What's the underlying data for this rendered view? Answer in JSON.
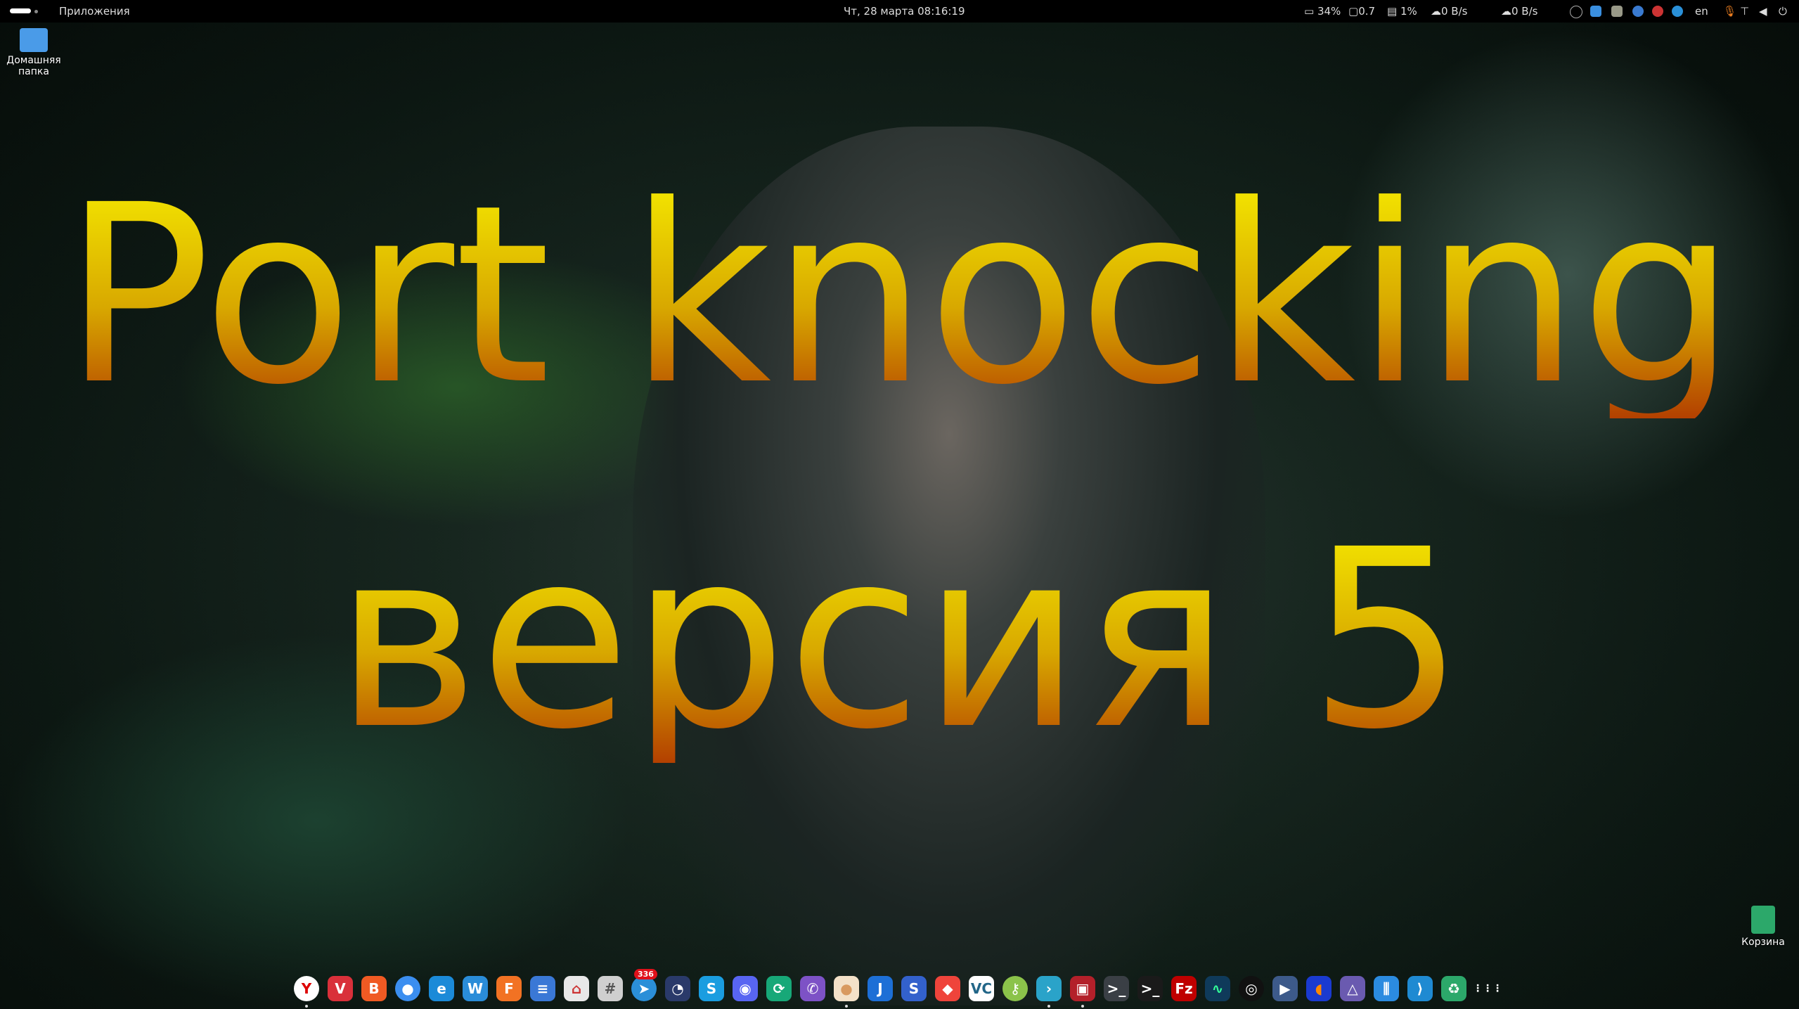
{
  "topbar": {
    "apps_label": "Приложения",
    "clock": "Чт, 28 марта  08:16:19",
    "cpu": "34%",
    "load": "0.7",
    "mem": "1%",
    "download": "0 B/s",
    "upload": "0 B/s",
    "lang": "en"
  },
  "desktop": {
    "home_folder": "Домашняя папка",
    "trash": "Корзина"
  },
  "wallpaper_text": {
    "line1": "Port knocking",
    "line2": "версия 5"
  },
  "dock": {
    "telegram_badge": "336",
    "apps": [
      {
        "name": "yandex-browser",
        "glyph": "Y",
        "color": "#ffffff",
        "fg": "#d00"
      },
      {
        "name": "vivaldi",
        "glyph": "V",
        "color": "#d9303a"
      },
      {
        "name": "brave",
        "glyph": "B",
        "color": "#f05a23"
      },
      {
        "name": "chrome",
        "glyph": "●",
        "color": "#3b8ef0"
      },
      {
        "name": "edge",
        "glyph": "e",
        "color": "#1b8ad8"
      },
      {
        "name": "wps",
        "glyph": "W",
        "color": "#2a8cd8"
      },
      {
        "name": "firefox",
        "glyph": "F",
        "color": "#f27223"
      },
      {
        "name": "file-cabinet",
        "glyph": "≡",
        "color": "#3a78d6"
      },
      {
        "name": "software-store",
        "glyph": "⌂",
        "color": "#e8e8e8",
        "fg": "#c33"
      },
      {
        "name": "calculator",
        "glyph": "#",
        "color": "#cfcfcf",
        "fg": "#555"
      },
      {
        "name": "telegram",
        "glyph": "➤",
        "color": "#2b8fd8"
      },
      {
        "name": "timeshift",
        "glyph": "◔",
        "color": "#2a3a6a"
      },
      {
        "name": "skype",
        "glyph": "S",
        "color": "#1a9de0"
      },
      {
        "name": "discord",
        "glyph": "◉",
        "color": "#5865f2"
      },
      {
        "name": "sync",
        "glyph": "⟳",
        "color": "#17a878"
      },
      {
        "name": "viber",
        "glyph": "✆",
        "color": "#7d52c6"
      },
      {
        "name": "notes",
        "glyph": "●",
        "color": "#f3e1c8",
        "fg": "#d89a60"
      },
      {
        "name": "jdownloader",
        "glyph": "J",
        "color": "#1d6fd6"
      },
      {
        "name": "simplenote",
        "glyph": "S",
        "color": "#3361cc"
      },
      {
        "name": "anydesk",
        "glyph": "◆",
        "color": "#ef443b"
      },
      {
        "name": "veracrypt",
        "glyph": "VC",
        "color": "#ffffff",
        "fg": "#268"
      },
      {
        "name": "keepass",
        "glyph": "⚷",
        "color": "#8bc34a"
      },
      {
        "name": "remmina",
        "glyph": "›",
        "color": "#2aa3c9"
      },
      {
        "name": "screen-recorder",
        "glyph": "▣",
        "color": "#b3202a"
      },
      {
        "name": "terminal",
        "glyph": ">_",
        "color": "#3a3f45"
      },
      {
        "name": "cool-retro-term",
        "glyph": ">_",
        "color": "#1a1a1a"
      },
      {
        "name": "filezilla",
        "glyph": "Fz",
        "color": "#bf0000"
      },
      {
        "name": "system-monitor",
        "glyph": "∿",
        "color": "#0f3a5a",
        "fg": "#3f9"
      },
      {
        "name": "obs",
        "glyph": "◎",
        "color": "#111111"
      },
      {
        "name": "ytdownloader",
        "glyph": "▶",
        "color": "#3d5a8a"
      },
      {
        "name": "audacity",
        "glyph": "◖",
        "color": "#1a3ad0",
        "fg": "#f80"
      },
      {
        "name": "kdenlive",
        "glyph": "△",
        "color": "#6a5ab0"
      },
      {
        "name": "equalizer",
        "glyph": "⫼",
        "color": "#2b8be0"
      },
      {
        "name": "vscode",
        "glyph": "⟩",
        "color": "#1f8ad2"
      },
      {
        "name": "trash",
        "glyph": "♻",
        "color": "#2ca86a"
      },
      {
        "name": "show-apps",
        "glyph": "⋮⋮⋮",
        "color": "transparent"
      }
    ]
  }
}
